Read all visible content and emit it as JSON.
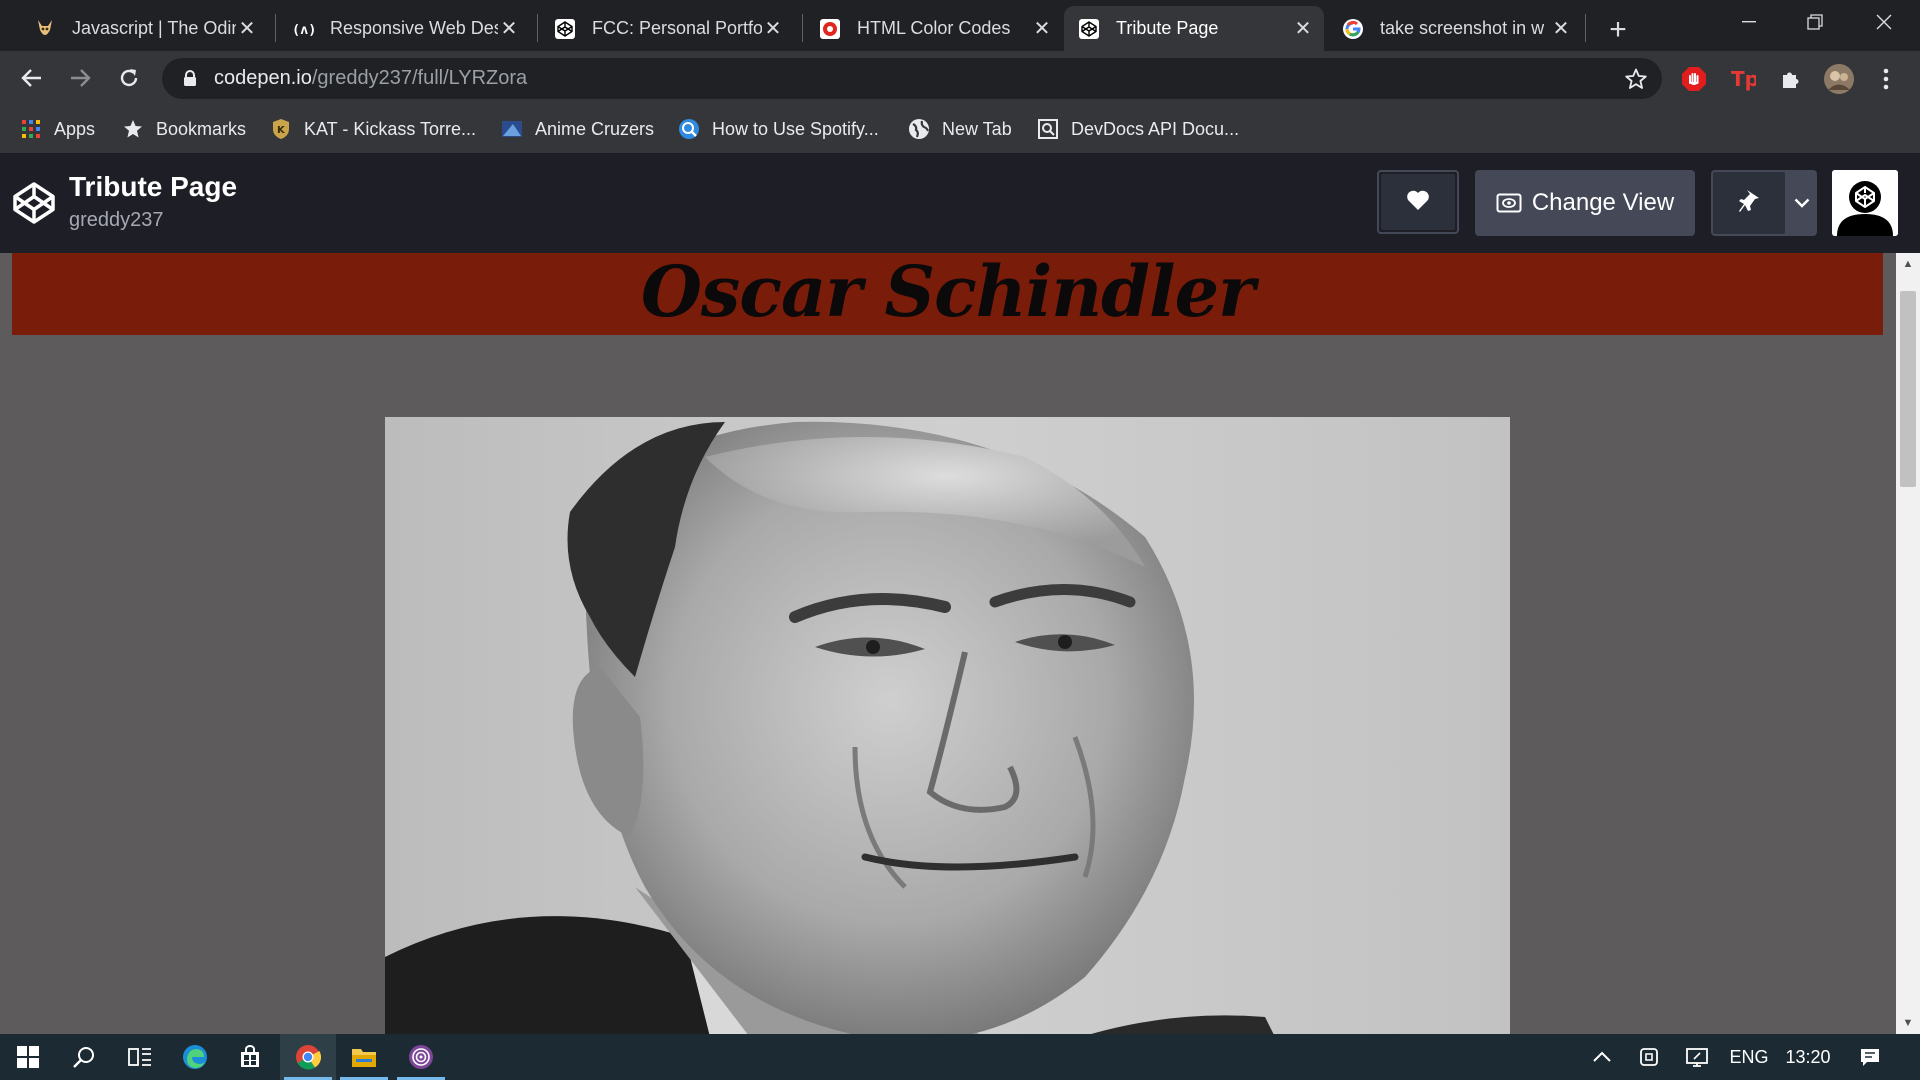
{
  "browser": {
    "tabs": [
      {
        "title": "Javascript | The Odin",
        "icon": "odin-icon",
        "active": false
      },
      {
        "title": "Responsive Web Des",
        "icon": "fcc-icon",
        "active": false
      },
      {
        "title": "FCC: Personal Portfol",
        "icon": "codepen-icon",
        "active": false
      },
      {
        "title": "HTML Color Codes",
        "icon": "color-codes-icon",
        "active": false
      },
      {
        "title": "Tribute Page",
        "icon": "codepen-icon",
        "active": true
      },
      {
        "title": "take screenshot in w",
        "icon": "google-icon",
        "active": false
      }
    ],
    "url": {
      "host": "codepen.io",
      "path": "/greddy237/full/LYRZora"
    },
    "bookmarks": [
      {
        "label": "Apps",
        "icon": "apps-grid-icon"
      },
      {
        "label": "Bookmarks",
        "icon": "star-icon"
      },
      {
        "label": "KAT - Kickass Torre...",
        "icon": "kat-icon"
      },
      {
        "label": "Anime Cruzers",
        "icon": "anime-icon"
      },
      {
        "label": "How to Use Spotify...",
        "icon": "spotify-help-icon"
      },
      {
        "label": "New Tab",
        "icon": "globe-icon"
      },
      {
        "label": "DevDocs API Docu...",
        "icon": "devdocs-icon"
      }
    ]
  },
  "codepen": {
    "pen_title": "Tribute Page",
    "username": "greddy237",
    "change_view_label": "Change View"
  },
  "page": {
    "heading": "Oscar Schindler"
  },
  "taskbar": {
    "language": "ENG",
    "time": "13:20"
  },
  "colors": {
    "banner": "#791c09",
    "page_bg": "#5d5b5b",
    "codepen_header": "#1e1f26",
    "chrome_frame": "#202124",
    "chrome_toolbar": "#35363a"
  }
}
